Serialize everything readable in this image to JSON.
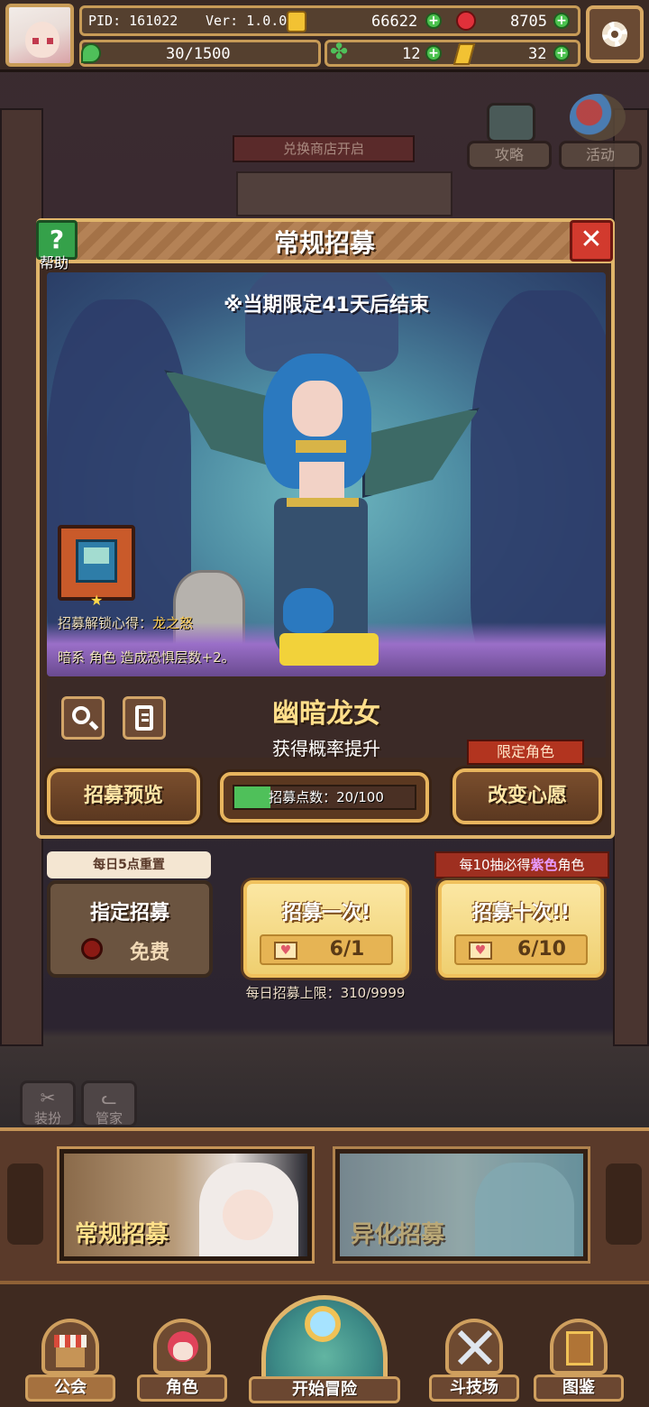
{
  "player": {
    "pid": "PID: 161022",
    "version": "Ver: 1.0.0.0",
    "energy": "30/1500"
  },
  "currency": {
    "gold": "66622",
    "ruby": "8705",
    "clover": "12",
    "ticket": "32"
  },
  "background": {
    "shop_sign": "兑换商店开启",
    "guide_label": "攻略",
    "event_label": "活动",
    "outfit_label": "装扮",
    "butler_label": "管家"
  },
  "modal": {
    "title": "常规招募",
    "help_label": "帮助",
    "close_symbol": "✕",
    "time_limit": "※当期限定41天后结束",
    "unlock_prefix": "招募解锁心得：",
    "unlock_name": "龙之怒",
    "effect": "暗系 角色 造成恐惧层数+2。",
    "character_name": "幽暗龙女",
    "rate_up": "获得概率提升",
    "limited_tag": "限定角色",
    "preview_button": "招募预览",
    "points_label": "招募点数：20/100",
    "points_fraction": 0.2,
    "wish_button": "改变心愿"
  },
  "draws": {
    "daily_reset_tag": "每日5点重置",
    "designated_title": "指定招募",
    "designated_cost": "免费",
    "single_title": "招募一次!",
    "single_cost": "6/1",
    "ten_title": "招募十次!!",
    "ten_cost": "6/10",
    "guarantee_prefix": "每10抽必得",
    "guarantee_color_word": "紫色",
    "guarantee_suffix": "角色",
    "daily_limit": "每日招募上限：310/9999"
  },
  "banners": {
    "regular": "常规招募",
    "alternate": "异化招募"
  },
  "nav": {
    "guild": "公会",
    "character": "角色",
    "adventure": "开始冒险",
    "arena": "斗技场",
    "codex": "图鉴"
  },
  "colors": {
    "accent_gold": "#e0b56a",
    "progress_green": "#4fc05a",
    "close_red": "#d23a2e",
    "help_green": "#35a14a",
    "guarantee_purple": "#e79bff"
  }
}
